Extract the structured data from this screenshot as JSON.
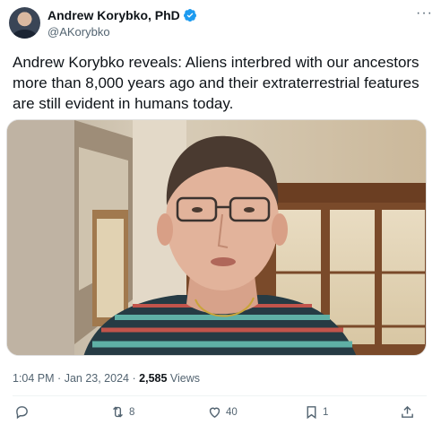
{
  "author": {
    "display_name": "Andrew Korybko, PhD",
    "handle": "@AKorybko"
  },
  "tweet": {
    "text": "Andrew Korybko reveals: Aliens interbred with our ancestors more than 8,000 years ago and their extraterrestrial features are still evident in humans today."
  },
  "meta": {
    "time": "1:04 PM",
    "separator": "·",
    "date": "Jan 23, 2024",
    "views_count": "2,585",
    "views_label": "Views"
  },
  "actions": {
    "replies": "",
    "reposts": "8",
    "likes": "40",
    "bookmarks": "1"
  },
  "colors": {
    "verified_blue": "#1d9bf0",
    "secondary_text": "#536471",
    "primary_text": "#0f1419"
  },
  "icons": [
    "more-icon",
    "verified-badge-icon",
    "reply-icon",
    "repost-icon",
    "like-icon",
    "bookmark-icon",
    "share-icon"
  ]
}
